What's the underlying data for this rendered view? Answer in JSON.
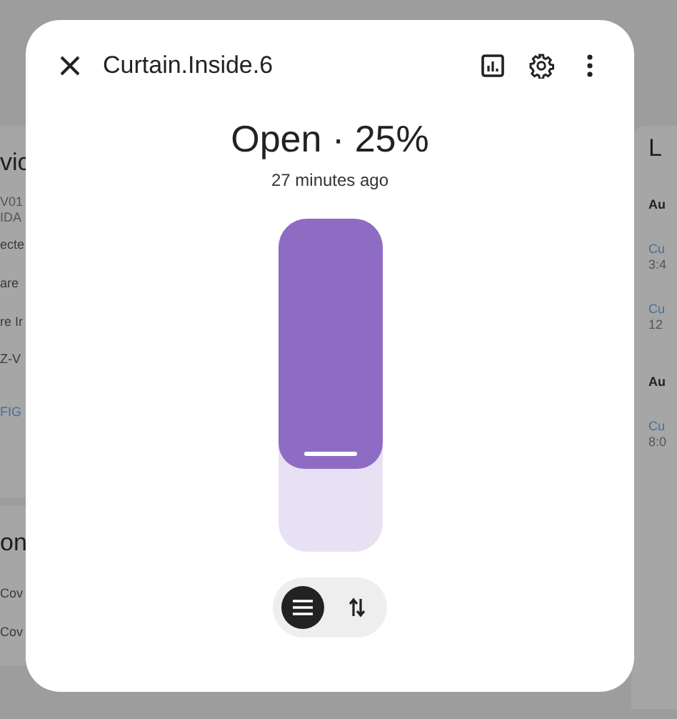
{
  "background_left": [
    {
      "items": [
        {
          "kind": "title",
          "text": "vic"
        },
        {
          "kind": "text",
          "text": "V01"
        },
        {
          "kind": "text",
          "text": "IDA"
        },
        {
          "kind": "label",
          "text": "ecte"
        },
        {
          "kind": "label",
          "text": "are"
        },
        {
          "kind": "label",
          "text": "re Ir"
        },
        {
          "kind": "label",
          "text": "Z-V"
        },
        {
          "kind": "link",
          "text": "FIG"
        }
      ]
    },
    {
      "items": [
        {
          "kind": "title",
          "text": "on"
        },
        {
          "kind": "label",
          "text": "Cov"
        },
        {
          "kind": "label",
          "text": "Cov"
        }
      ]
    }
  ],
  "background_right": [
    {
      "kind": "title",
      "text": "L"
    },
    {
      "kind": "heading",
      "text": "Au"
    },
    {
      "kind": "link",
      "text": "Cu"
    },
    {
      "kind": "text",
      "text": "3:4"
    },
    {
      "kind": "link",
      "text": "Cu"
    },
    {
      "kind": "text",
      "text": "12"
    },
    {
      "kind": "heading",
      "text": "Au"
    },
    {
      "kind": "link",
      "text": "Cu"
    },
    {
      "kind": "text",
      "text": "8:0"
    }
  ],
  "dialog": {
    "title": "Curtain.Inside.6",
    "state": "Open · 25%",
    "last_changed": "27 minutes ago",
    "position": {
      "level": 0.75
    },
    "modes": [
      {
        "kind": "slider",
        "selected": true
      },
      {
        "kind": "buttons",
        "selected": false
      }
    ]
  }
}
